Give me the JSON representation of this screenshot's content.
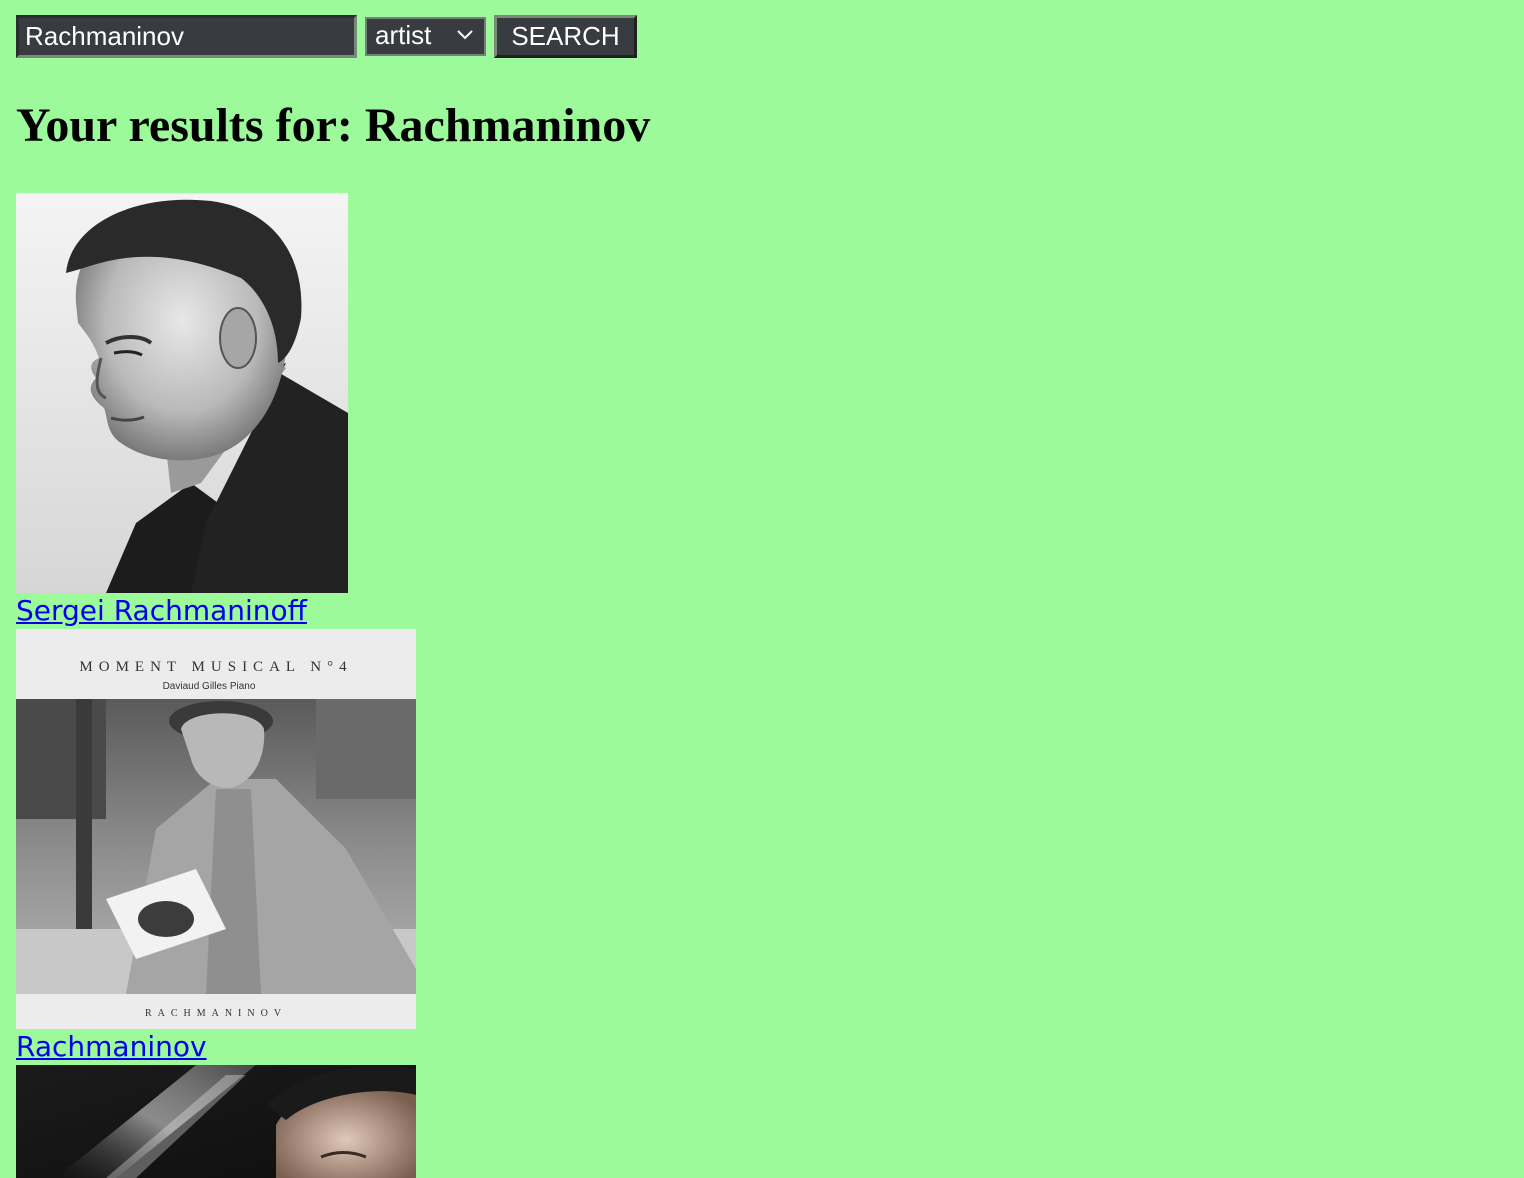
{
  "search": {
    "query": "Rachmaninov",
    "type_selected": "artist",
    "button_label": "SEARCH"
  },
  "heading": "Your results for: Rachmaninov",
  "results": [
    {
      "name": "Sergei Rachmaninoff",
      "image": "portrait-photo"
    },
    {
      "name": "Rachmaninov",
      "image": "album-cover",
      "cover_title": "MOMENT MUSICAL   N°4",
      "cover_subtitle": "Daviaud Gilles Piano",
      "cover_footer": "RACHMANINOV"
    },
    {
      "image": "photo"
    }
  ],
  "colors": {
    "background": "#9cfa9a",
    "link": "#0000ee",
    "control_bg": "#383b40"
  }
}
